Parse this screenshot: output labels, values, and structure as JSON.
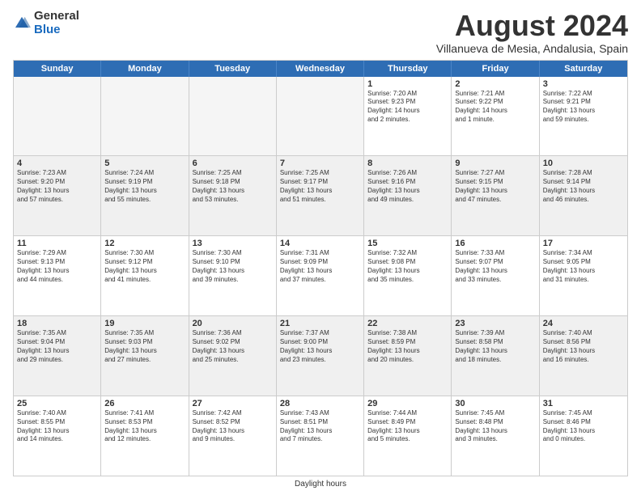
{
  "logo": {
    "general": "General",
    "blue": "Blue"
  },
  "title": "August 2024",
  "subtitle": "Villanueva de Mesia, Andalusia, Spain",
  "days": [
    "Sunday",
    "Monday",
    "Tuesday",
    "Wednesday",
    "Thursday",
    "Friday",
    "Saturday"
  ],
  "footer": "Daylight hours",
  "weeks": [
    [
      {
        "day": "",
        "empty": true
      },
      {
        "day": "",
        "empty": true
      },
      {
        "day": "",
        "empty": true
      },
      {
        "day": "",
        "empty": true
      },
      {
        "day": "1",
        "line1": "Sunrise: 7:20 AM",
        "line2": "Sunset: 9:23 PM",
        "line3": "Daylight: 14 hours",
        "line4": "and 2 minutes."
      },
      {
        "day": "2",
        "line1": "Sunrise: 7:21 AM",
        "line2": "Sunset: 9:22 PM",
        "line3": "Daylight: 14 hours",
        "line4": "and 1 minute."
      },
      {
        "day": "3",
        "line1": "Sunrise: 7:22 AM",
        "line2": "Sunset: 9:21 PM",
        "line3": "Daylight: 13 hours",
        "line4": "and 59 minutes."
      }
    ],
    [
      {
        "day": "4",
        "line1": "Sunrise: 7:23 AM",
        "line2": "Sunset: 9:20 PM",
        "line3": "Daylight: 13 hours",
        "line4": "and 57 minutes."
      },
      {
        "day": "5",
        "line1": "Sunrise: 7:24 AM",
        "line2": "Sunset: 9:19 PM",
        "line3": "Daylight: 13 hours",
        "line4": "and 55 minutes."
      },
      {
        "day": "6",
        "line1": "Sunrise: 7:25 AM",
        "line2": "Sunset: 9:18 PM",
        "line3": "Daylight: 13 hours",
        "line4": "and 53 minutes."
      },
      {
        "day": "7",
        "line1": "Sunrise: 7:25 AM",
        "line2": "Sunset: 9:17 PM",
        "line3": "Daylight: 13 hours",
        "line4": "and 51 minutes."
      },
      {
        "day": "8",
        "line1": "Sunrise: 7:26 AM",
        "line2": "Sunset: 9:16 PM",
        "line3": "Daylight: 13 hours",
        "line4": "and 49 minutes."
      },
      {
        "day": "9",
        "line1": "Sunrise: 7:27 AM",
        "line2": "Sunset: 9:15 PM",
        "line3": "Daylight: 13 hours",
        "line4": "and 47 minutes."
      },
      {
        "day": "10",
        "line1": "Sunrise: 7:28 AM",
        "line2": "Sunset: 9:14 PM",
        "line3": "Daylight: 13 hours",
        "line4": "and 46 minutes."
      }
    ],
    [
      {
        "day": "11",
        "line1": "Sunrise: 7:29 AM",
        "line2": "Sunset: 9:13 PM",
        "line3": "Daylight: 13 hours",
        "line4": "and 44 minutes."
      },
      {
        "day": "12",
        "line1": "Sunrise: 7:30 AM",
        "line2": "Sunset: 9:12 PM",
        "line3": "Daylight: 13 hours",
        "line4": "and 41 minutes."
      },
      {
        "day": "13",
        "line1": "Sunrise: 7:30 AM",
        "line2": "Sunset: 9:10 PM",
        "line3": "Daylight: 13 hours",
        "line4": "and 39 minutes."
      },
      {
        "day": "14",
        "line1": "Sunrise: 7:31 AM",
        "line2": "Sunset: 9:09 PM",
        "line3": "Daylight: 13 hours",
        "line4": "and 37 minutes."
      },
      {
        "day": "15",
        "line1": "Sunrise: 7:32 AM",
        "line2": "Sunset: 9:08 PM",
        "line3": "Daylight: 13 hours",
        "line4": "and 35 minutes."
      },
      {
        "day": "16",
        "line1": "Sunrise: 7:33 AM",
        "line2": "Sunset: 9:07 PM",
        "line3": "Daylight: 13 hours",
        "line4": "and 33 minutes."
      },
      {
        "day": "17",
        "line1": "Sunrise: 7:34 AM",
        "line2": "Sunset: 9:05 PM",
        "line3": "Daylight: 13 hours",
        "line4": "and 31 minutes."
      }
    ],
    [
      {
        "day": "18",
        "line1": "Sunrise: 7:35 AM",
        "line2": "Sunset: 9:04 PM",
        "line3": "Daylight: 13 hours",
        "line4": "and 29 minutes."
      },
      {
        "day": "19",
        "line1": "Sunrise: 7:35 AM",
        "line2": "Sunset: 9:03 PM",
        "line3": "Daylight: 13 hours",
        "line4": "and 27 minutes."
      },
      {
        "day": "20",
        "line1": "Sunrise: 7:36 AM",
        "line2": "Sunset: 9:02 PM",
        "line3": "Daylight: 13 hours",
        "line4": "and 25 minutes."
      },
      {
        "day": "21",
        "line1": "Sunrise: 7:37 AM",
        "line2": "Sunset: 9:00 PM",
        "line3": "Daylight: 13 hours",
        "line4": "and 23 minutes."
      },
      {
        "day": "22",
        "line1": "Sunrise: 7:38 AM",
        "line2": "Sunset: 8:59 PM",
        "line3": "Daylight: 13 hours",
        "line4": "and 20 minutes."
      },
      {
        "day": "23",
        "line1": "Sunrise: 7:39 AM",
        "line2": "Sunset: 8:58 PM",
        "line3": "Daylight: 13 hours",
        "line4": "and 18 minutes."
      },
      {
        "day": "24",
        "line1": "Sunrise: 7:40 AM",
        "line2": "Sunset: 8:56 PM",
        "line3": "Daylight: 13 hours",
        "line4": "and 16 minutes."
      }
    ],
    [
      {
        "day": "25",
        "line1": "Sunrise: 7:40 AM",
        "line2": "Sunset: 8:55 PM",
        "line3": "Daylight: 13 hours",
        "line4": "and 14 minutes."
      },
      {
        "day": "26",
        "line1": "Sunrise: 7:41 AM",
        "line2": "Sunset: 8:53 PM",
        "line3": "Daylight: 13 hours",
        "line4": "and 12 minutes."
      },
      {
        "day": "27",
        "line1": "Sunrise: 7:42 AM",
        "line2": "Sunset: 8:52 PM",
        "line3": "Daylight: 13 hours",
        "line4": "and 9 minutes."
      },
      {
        "day": "28",
        "line1": "Sunrise: 7:43 AM",
        "line2": "Sunset: 8:51 PM",
        "line3": "Daylight: 13 hours",
        "line4": "and 7 minutes."
      },
      {
        "day": "29",
        "line1": "Sunrise: 7:44 AM",
        "line2": "Sunset: 8:49 PM",
        "line3": "Daylight: 13 hours",
        "line4": "and 5 minutes."
      },
      {
        "day": "30",
        "line1": "Sunrise: 7:45 AM",
        "line2": "Sunset: 8:48 PM",
        "line3": "Daylight: 13 hours",
        "line4": "and 3 minutes."
      },
      {
        "day": "31",
        "line1": "Sunrise: 7:45 AM",
        "line2": "Sunset: 8:46 PM",
        "line3": "Daylight: 13 hours",
        "line4": "and 0 minutes."
      }
    ]
  ]
}
